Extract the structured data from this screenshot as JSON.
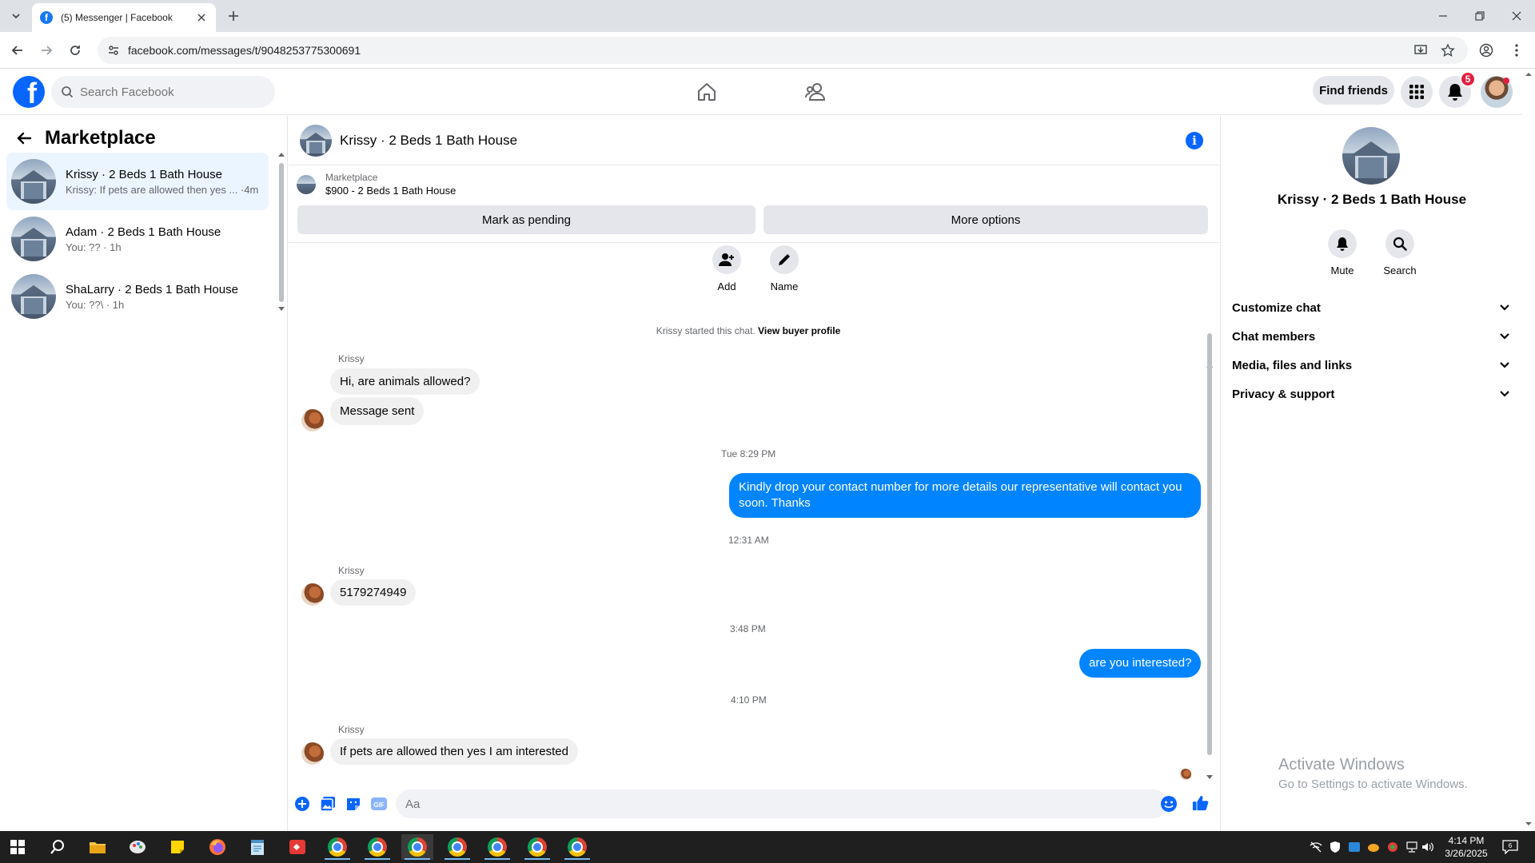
{
  "browser": {
    "tab_title": "(5) Messenger | Facebook",
    "url": "facebook.com/messages/t/9048253775300691"
  },
  "header": {
    "search_placeholder": "Search Facebook",
    "find_friends": "Find friends",
    "notification_count": "5"
  },
  "left": {
    "title": "Marketplace",
    "conversations": [
      {
        "name": "Krissy · 2 Beds 1 Bath House",
        "preview": "Krissy: If pets are allowed then yes ... ·4m"
      },
      {
        "name": "Adam · 2 Beds 1 Bath House",
        "preview": "You: ?? · 1h"
      },
      {
        "name": "ShaLarry · 2 Beds 1 Bath House",
        "preview": "You: ??\\ · 1h"
      }
    ]
  },
  "chat": {
    "title": "Krissy · 2 Beds 1 Bath House",
    "listing_label": "Marketplace",
    "listing_detail": "$900 - 2 Beds 1 Bath House",
    "mark_pending": "Mark as pending",
    "more_options": "More options",
    "add_label": "Add",
    "name_label": "Name",
    "started_text": "Krissy started this chat.",
    "view_profile": "View buyer profile",
    "sender_name": "Krissy",
    "messages": {
      "m1": "Hi, are animals allowed?",
      "m2": "Message sent",
      "ts1": "Tue 8:29 PM",
      "m3": "Kindly drop your contact number for more details our representative will contact you soon. Thanks",
      "ts2": "12:31 AM",
      "m4": "5179274949",
      "ts3": "3:48 PM",
      "m5": "are you interested?",
      "ts4": "4:10 PM",
      "m6": "If pets are allowed then yes I am interested"
    },
    "composer_placeholder": "Aa",
    "gif_label": "GIF"
  },
  "right": {
    "name": "Krissy · 2 Beds 1 Bath House",
    "mute": "Mute",
    "search": "Search",
    "sections": [
      "Customize chat",
      "Chat members",
      "Media, files and links",
      "Privacy & support"
    ],
    "activate_title": "Activate Windows",
    "activate_sub": "Go to Settings to activate Windows."
  },
  "taskbar": {
    "time": "4:14 PM",
    "date": "3/26/2025",
    "notifications": "6"
  },
  "colors": {
    "facebook_blue": "#0866ff",
    "outgoing_bubble": "#0084ff",
    "badge_red": "#e41e3f"
  }
}
